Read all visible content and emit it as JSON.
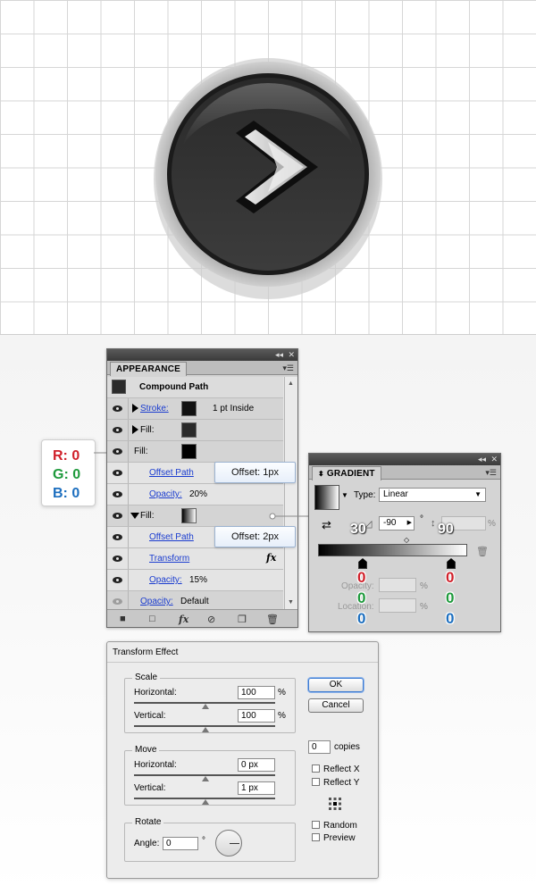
{
  "appearance": {
    "tab": "APPEARANCE",
    "object_name": "Compound Path",
    "rows": [
      {
        "label": "Stroke:",
        "value": "1 pt  Inside"
      },
      {
        "label": "Fill:"
      },
      {
        "label": "Fill:"
      },
      {
        "label": "Offset Path"
      },
      {
        "label": "Opacity:",
        "value": "20%"
      },
      {
        "label": "Fill:"
      },
      {
        "label": "Offset Path"
      },
      {
        "label": "Transform"
      },
      {
        "label": "Opacity:",
        "value": "15%"
      },
      {
        "label": "Opacity:",
        "value": "Default"
      }
    ],
    "callout_offset_1": "Offset: 1px",
    "callout_offset_2": "Offset: 2px",
    "fx_glyph": "fx"
  },
  "rgb_note": {
    "r": "R: 0",
    "g": "G: 0",
    "b": "B: 0"
  },
  "gradient": {
    "tab": "GRADIENT",
    "type_label": "Type:",
    "type_value": "Linear",
    "angle_value": "-90",
    "angle_unit": "°",
    "aspect_unit": "%",
    "opacity_label": "Opacity:",
    "location_label": "Location:",
    "pct": "%",
    "annot_angle": "30",
    "annot_aspect": "90",
    "stop_left": {
      "r": "0",
      "g": "0",
      "b": "0"
    },
    "stop_right": {
      "r": "0",
      "g": "0",
      "b": "0"
    },
    "stop_left_opacity": 1.0,
    "stop_right_opacity": 0.0
  },
  "transform": {
    "title": "Transform Effect",
    "scale_title": "Scale",
    "scale_h_label": "Horizontal:",
    "scale_h_value": "100",
    "scale_v_label": "Vertical:",
    "scale_v_value": "100",
    "pct": "%",
    "move_title": "Move",
    "move_h_label": "Horizontal:",
    "move_h_value": "0 px",
    "move_v_label": "Vertical:",
    "move_v_value": "1 px",
    "rotate_title": "Rotate",
    "angle_label": "Angle:",
    "angle_value": "0",
    "degree": "°",
    "ok": "OK",
    "cancel": "Cancel",
    "copies_value": "0",
    "copies_label": "copies",
    "reflect_x": "Reflect X",
    "reflect_y": "Reflect Y",
    "random": "Random",
    "preview": "Preview"
  }
}
